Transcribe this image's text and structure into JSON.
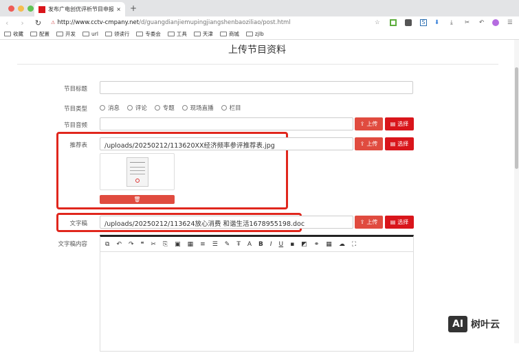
{
  "browser": {
    "tab_title": "发布广电创优评析节目申报 - C",
    "tab_close": "×",
    "new_tab": "+",
    "url_host": "http://www.cctv-cmpany.net",
    "url_path": "/d/guangdianjiemupingjiangshenbaoziliao/post.html",
    "bookmarks": [
      "收藏",
      "配置",
      "开发",
      "url",
      "领读行",
      "专委会",
      "工具",
      "天津",
      "商城",
      "zjlb"
    ]
  },
  "page": {
    "title": "上传节目资料",
    "fields": {
      "title_label": "节目标题",
      "type_label": "节目类型",
      "types": [
        "消息",
        "评论",
        "专题",
        "现场直播",
        "栏目"
      ],
      "audio_label": "节目音频",
      "rec_label": "推荐表",
      "rec_value": "/uploads/20250212/113620XX经济频率参评推荐表.jpg",
      "doc_label": "文字稿",
      "doc_value": "/uploads/20250212/113624放心消费 和谐生活1678955198.doc",
      "content_label": "文字稿内容"
    },
    "upload_label": "上传",
    "select_label": "选择"
  },
  "watermark": {
    "logo": "AI",
    "text": "树叶云"
  },
  "colors": {
    "accent": "#d9151b",
    "upload": "#e04b3f",
    "highlight": "#e0261c"
  }
}
